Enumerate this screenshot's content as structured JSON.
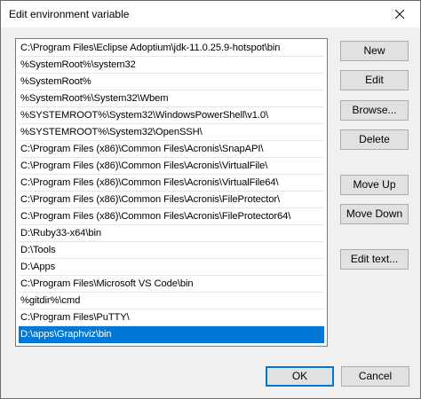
{
  "window": {
    "title": "Edit environment variable"
  },
  "list": {
    "items": [
      "C:\\Program Files\\Eclipse Adoptium\\jdk-11.0.25.9-hotspot\\bin",
      "%SystemRoot%\\system32",
      "%SystemRoot%",
      "%SystemRoot%\\System32\\Wbem",
      "%SYSTEMROOT%\\System32\\WindowsPowerShell\\v1.0\\",
      "%SYSTEMROOT%\\System32\\OpenSSH\\",
      "C:\\Program Files (x86)\\Common Files\\Acronis\\SnapAPI\\",
      "C:\\Program Files (x86)\\Common Files\\Acronis\\VirtualFile\\",
      "C:\\Program Files (x86)\\Common Files\\Acronis\\VirtualFile64\\",
      "C:\\Program Files (x86)\\Common Files\\Acronis\\FileProtector\\",
      "C:\\Program Files (x86)\\Common Files\\Acronis\\FileProtector64\\",
      "D:\\Ruby33-x64\\bin",
      "D:\\Tools",
      "D:\\Apps",
      "C:\\Program Files\\Microsoft VS Code\\bin",
      "%gitdir%\\cmd",
      "C:\\Program Files\\PuTTY\\",
      "D:\\apps\\Graphviz\\bin"
    ],
    "selected_index": 17
  },
  "buttons": {
    "new": "New",
    "edit": "Edit",
    "browse": "Browse...",
    "delete": "Delete",
    "move_up": "Move Up",
    "move_down": "Move Down",
    "edit_text": "Edit text...",
    "ok": "OK",
    "cancel": "Cancel"
  },
  "colors": {
    "selection": "#0078d7",
    "dialog_background": "#f0f0f0",
    "button_face": "#e1e1e1"
  },
  "icons": {
    "close": "close-icon"
  }
}
